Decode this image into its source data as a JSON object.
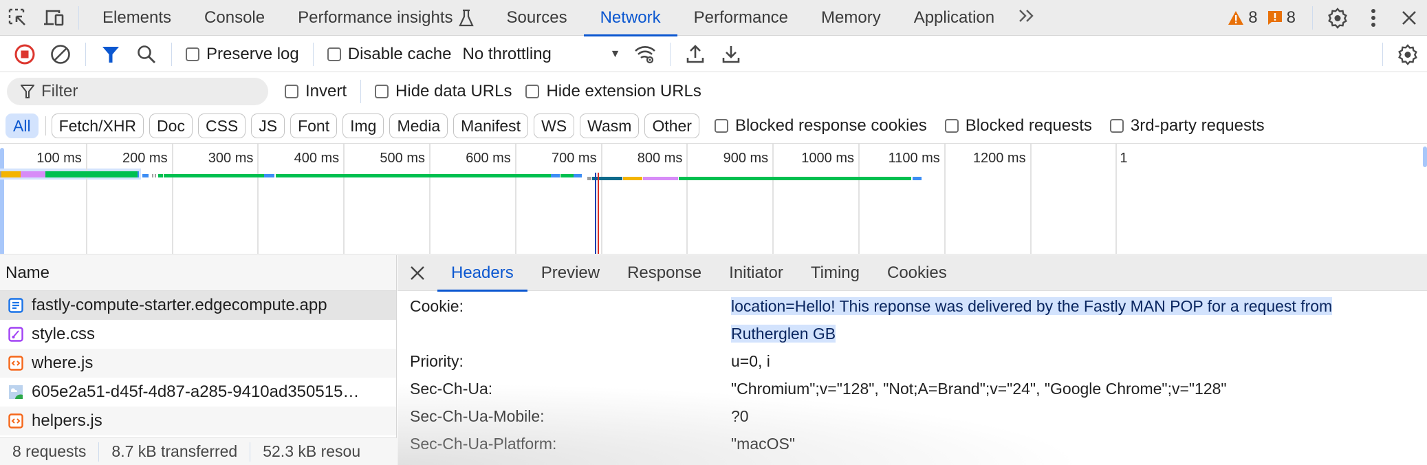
{
  "devtools": {
    "top_tabs": [
      {
        "label": "Elements"
      },
      {
        "label": "Console"
      },
      {
        "label": "Performance insights"
      },
      {
        "label": "Sources"
      },
      {
        "label": "Network",
        "active": true
      },
      {
        "label": "Performance"
      },
      {
        "label": "Memory"
      },
      {
        "label": "Application"
      }
    ],
    "warnings_count": "8",
    "issues_count": "8",
    "colors": {
      "accent": "#0b57d0",
      "warning": "#e8710a",
      "record": "#dc362e"
    }
  },
  "toolbar": {
    "preserve_log_label": "Preserve log",
    "disable_cache_label": "Disable cache",
    "throttling_value": "No throttling"
  },
  "filter": {
    "placeholder": "Filter",
    "invert_label": "Invert",
    "hide_data_urls_label": "Hide data URLs",
    "hide_extension_urls_label": "Hide extension URLs"
  },
  "type_filters": {
    "chips": [
      "All",
      "Fetch/XHR",
      "Doc",
      "CSS",
      "JS",
      "Font",
      "Img",
      "Media",
      "Manifest",
      "WS",
      "Wasm",
      "Other"
    ],
    "active": "All",
    "blocked_cookies_label": "Blocked response cookies",
    "blocked_requests_label": "Blocked requests",
    "third_party_label": "3rd-party requests"
  },
  "overview": {
    "tick_labels": [
      "100 ms",
      "200 ms",
      "300 ms",
      "400 ms",
      "500 ms",
      "600 ms",
      "700 ms",
      "800 ms",
      "900 ms",
      "1000 ms",
      "1100 ms",
      "1200 ms",
      "1"
    ],
    "ticks_ms": [
      100,
      200,
      300,
      400,
      500,
      600,
      700,
      800,
      900,
      1000,
      1100,
      1200,
      1300
    ],
    "dom_content_loaded_ms": 693,
    "load_ms": 696,
    "segments": [
      {
        "row": 0,
        "start": 0,
        "end": 2,
        "color": "#a0a0a0"
      },
      {
        "row": 0,
        "start": 2,
        "end": 24,
        "color": "#f4b400"
      },
      {
        "row": 0,
        "start": 24,
        "end": 53,
        "color": "#d78cf7"
      },
      {
        "row": 0,
        "start": 53,
        "end": 160,
        "color": "#00c050"
      },
      {
        "row": 0,
        "start": 160,
        "end": 162,
        "color": "#3c8df5"
      },
      {
        "row": 1,
        "start": 166,
        "end": 173,
        "color": "#3c8df5"
      },
      {
        "row": 1,
        "start": 177,
        "end": 179,
        "color": "#a0a0a0"
      },
      {
        "row": 1,
        "start": 180,
        "end": 182,
        "color": "#a0a0a0"
      },
      {
        "row": 1,
        "start": 184,
        "end": 190,
        "color": "#00c050"
      },
      {
        "row": 1,
        "start": 191,
        "end": 308,
        "color": "#00c050"
      },
      {
        "row": 1,
        "start": 308,
        "end": 320,
        "color": "#3c8df5"
      },
      {
        "row": 1,
        "start": 321,
        "end": 642,
        "color": "#00c050"
      },
      {
        "row": 1,
        "start": 642,
        "end": 652,
        "color": "#3c8df5"
      },
      {
        "row": 1,
        "start": 653,
        "end": 668,
        "color": "#00c050"
      },
      {
        "row": 1,
        "start": 668,
        "end": 678,
        "color": "#3c8df5"
      },
      {
        "row": 2,
        "start": 684,
        "end": 689,
        "color": "#a0a0a0"
      },
      {
        "row": 2,
        "start": 690,
        "end": 725,
        "color": "#0f6a8b"
      },
      {
        "row": 2,
        "start": 726,
        "end": 748,
        "color": "#f4b400"
      },
      {
        "row": 2,
        "start": 749,
        "end": 790,
        "color": "#d78cf7"
      },
      {
        "row": 2,
        "start": 791,
        "end": 1062,
        "color": "#00c050"
      },
      {
        "row": 2,
        "start": 1063,
        "end": 1074,
        "color": "#3c8df5"
      }
    ]
  },
  "requests": {
    "column_name": "Name",
    "items": [
      {
        "name": "fastly-compute-starter.edgecompute.app",
        "type": "document",
        "selected": true
      },
      {
        "name": "style.css",
        "type": "stylesheet"
      },
      {
        "name": "where.js",
        "type": "script"
      },
      {
        "name": "605e2a51-d45f-4d87-a285-9410ad350515…",
        "type": "image"
      },
      {
        "name": "helpers.js",
        "type": "script"
      }
    ],
    "status": {
      "requests": "8 requests",
      "transferred": "8.7 kB transferred",
      "resources": "52.3 kB resou"
    }
  },
  "details": {
    "tabs": [
      "Headers",
      "Preview",
      "Response",
      "Initiator",
      "Timing",
      "Cookies"
    ],
    "active_tab": "Headers",
    "headers": [
      {
        "key": "Cookie:",
        "value": "location=Hello! This reponse was delivered by the Fastly MAN POP for a request from Rutherglen GB",
        "highlighted": true
      },
      {
        "key": "Priority:",
        "value": "u=0, i"
      },
      {
        "key": "Sec-Ch-Ua:",
        "value": "\"Chromium\";v=\"128\", \"Not;A=Brand\";v=\"24\", \"Google Chrome\";v=\"128\""
      },
      {
        "key": "Sec-Ch-Ua-Mobile:",
        "value": "?0"
      },
      {
        "key": "Sec-Ch-Ua-Platform:",
        "value": "\"macOS\""
      }
    ]
  }
}
